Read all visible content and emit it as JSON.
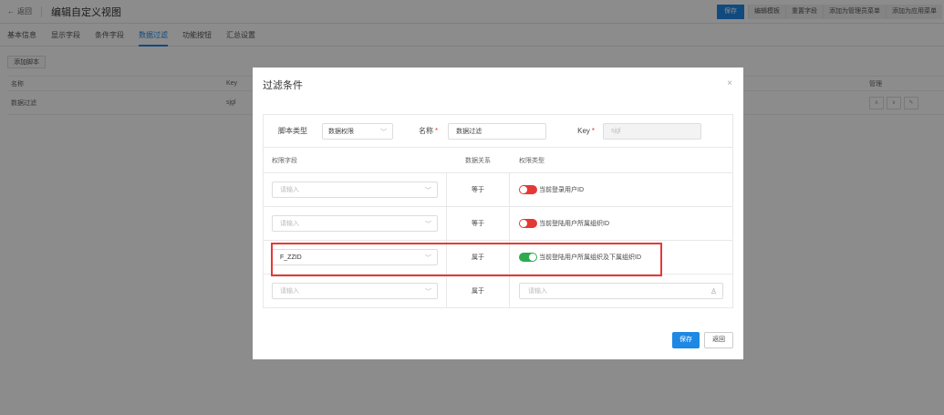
{
  "header": {
    "back_label": "返回",
    "title": "编辑自定义视图",
    "actions": [
      "保存",
      "编辑模板",
      "重置字段",
      "添加为管理员菜单",
      "添加为应用菜单"
    ]
  },
  "tabs": [
    "基本信息",
    "显示字段",
    "条件字段",
    "数据过滤",
    "功能按钮",
    "汇总设置"
  ],
  "active_tab": "数据过滤",
  "script_list": {
    "add_button": "添加脚本",
    "columns": {
      "name": "名称",
      "key": "Key",
      "manage": "管理"
    },
    "rows": [
      {
        "name": "数据过滤",
        "key": "sjgl"
      }
    ]
  },
  "dialog": {
    "title": "过滤条件",
    "close": "×",
    "script_type_label": "脚本类型",
    "script_type_value": "数据权限",
    "name_label": "名称",
    "name_value": "数据过滤",
    "key_label": "Key",
    "key_value": "sjgl",
    "required_mark": "*",
    "columns": {
      "field": "权限字段",
      "relation": "数据关系",
      "perm_type": "权限类型"
    },
    "rows": [
      {
        "field": "",
        "field_placeholder": "请输入",
        "relation": "等于",
        "perm_text": "当前登录用户ID",
        "toggle": "off"
      },
      {
        "field": "",
        "field_placeholder": "请输入",
        "relation": "等于",
        "perm_text": "当前登陆用户所属组织ID",
        "toggle": "off"
      },
      {
        "field": "F_ZZID",
        "field_placeholder": "",
        "relation": "属于",
        "perm_text": "当前登陆用户所属组织及下属组织ID",
        "toggle": "on"
      },
      {
        "field": "",
        "field_placeholder": "请输入",
        "relation": "属于",
        "perm_input_placeholder": "请输入"
      }
    ],
    "save_label": "保存",
    "return_label": "返回"
  },
  "colors": {
    "primary": "#1e88e5",
    "toggle_off": "#e53935",
    "toggle_on": "#2eaa4f",
    "highlight": "#e53935"
  }
}
